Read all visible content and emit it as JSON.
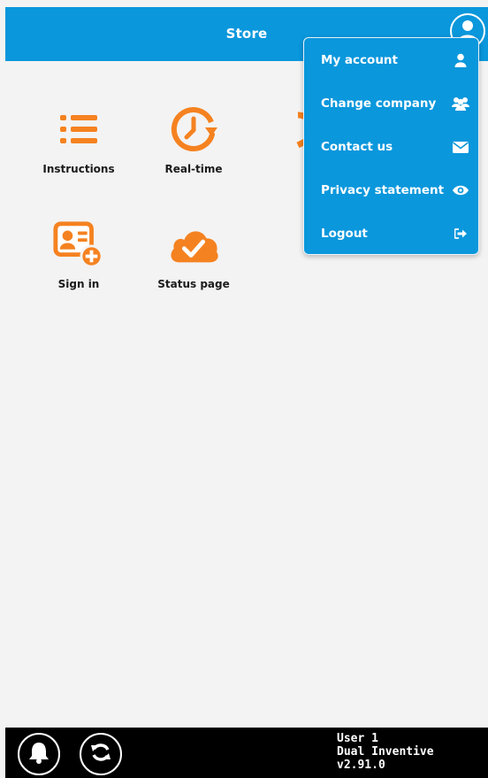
{
  "header": {
    "title": "Store"
  },
  "tiles": [
    {
      "label": "Instructions",
      "icon": "list-icon"
    },
    {
      "label": "Real-time",
      "icon": "clock-refresh-icon"
    },
    {
      "label": "",
      "icon": "partial-refresh-icon"
    },
    {
      "label": "Sign in",
      "icon": "id-card-add-icon"
    },
    {
      "label": "Status page",
      "icon": "cloud-check-icon"
    }
  ],
  "dropdown": {
    "items": [
      {
        "label": "My account",
        "icon": "user-icon"
      },
      {
        "label": "Change company",
        "icon": "users-icon"
      },
      {
        "label": "Contact us",
        "icon": "envelope-icon"
      },
      {
        "label": "Privacy statement",
        "icon": "eye-icon"
      },
      {
        "label": "Logout",
        "icon": "sign-out-icon"
      }
    ]
  },
  "footer": {
    "user": "User 1",
    "company": "Dual Inventive",
    "version": "v2.91.0",
    "buttons": [
      "bell-icon",
      "refresh-icon"
    ]
  },
  "colors": {
    "brand_blue": "#0a97dc",
    "accent_orange": "#f58220",
    "background": "#f3f3f3",
    "footer": "#000000"
  }
}
